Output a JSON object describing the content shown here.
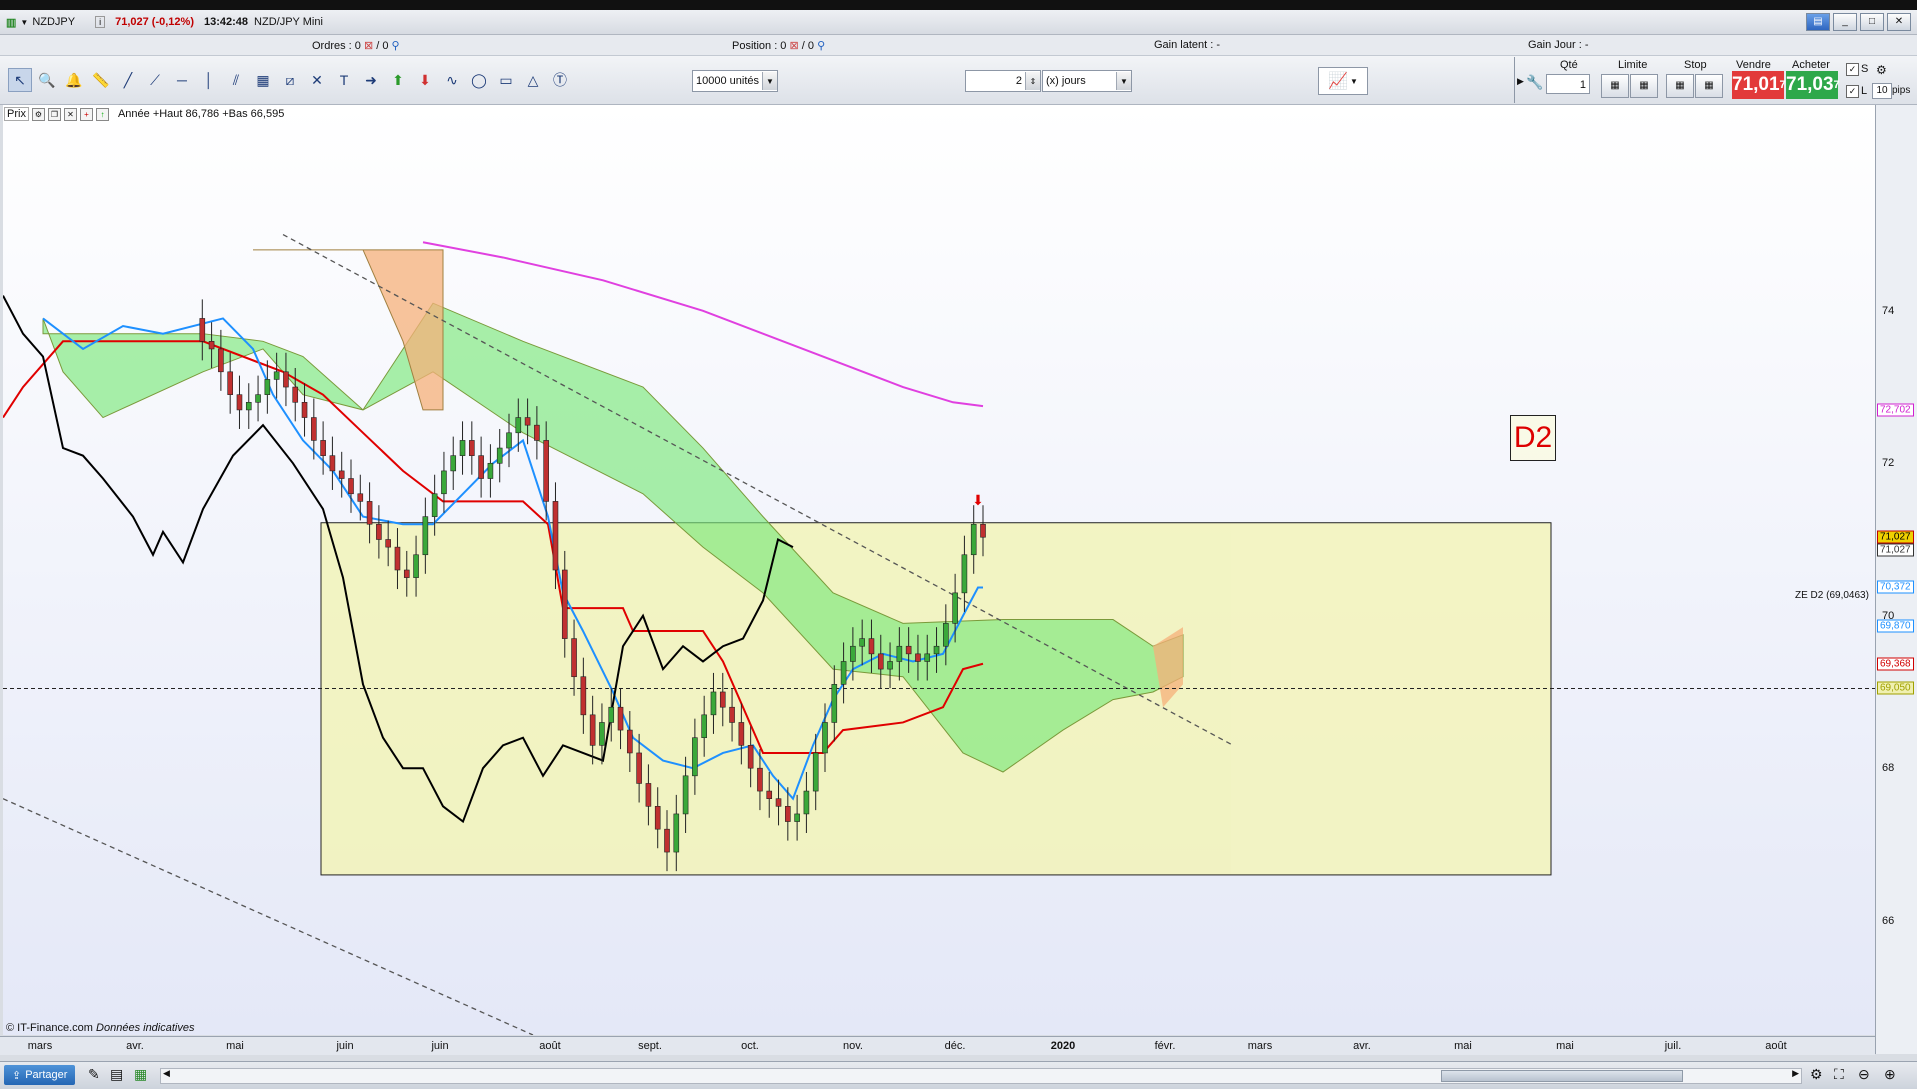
{
  "window": {
    "symbol": "NZDJPY",
    "price_change": "71,027 (-0,12%)",
    "time": "13:42:48",
    "instrument": "NZD/JPY Mini"
  },
  "infobar": {
    "orders_label": "Ordres : 0",
    "orders_second": "/ 0",
    "position_label": "Position : 0",
    "position_second": "/ 0",
    "gain_latent": "Gain latent : -",
    "gain_jour": "Gain Jour : -"
  },
  "toolbar": {
    "units_value": "10000 unités",
    "period_value": "2",
    "period_unit": "(x) jours"
  },
  "trade_panel": {
    "qty_label": "Qté",
    "qty_value": "1",
    "limit_label": "Limite",
    "stop_label": "Stop",
    "sell_label": "Vendre",
    "sell_price_main": "71,01",
    "sell_price_sup": "7",
    "buy_label": "Acheter",
    "buy_price_main": "71,03",
    "buy_price_sup": "7",
    "s_label": "S",
    "l_label": "L",
    "pips_value": "10",
    "pips_label": "pips"
  },
  "legend": {
    "text": "Prix",
    "range_text": "Année  +Haut 86,786  +Bas 66,595"
  },
  "chart_data": {
    "type": "candlestick",
    "title": "",
    "xlabel": "",
    "ylabel": "",
    "ylim": [
      64.5,
      76.7
    ],
    "y_ticks": [
      "74",
      "72",
      "70",
      "68",
      "66"
    ],
    "x_tick_labels": [
      "mars",
      "avr.",
      "mai",
      "juin",
      "juin",
      "août",
      "sept.",
      "oct.",
      "nov.",
      "déc.",
      "2020",
      "févr.",
      "mars",
      "avr.",
      "mai",
      "mai",
      "juil.",
      "août"
    ],
    "price_tags": [
      {
        "label": "72,702",
        "value": 72.702,
        "color": "#d020d0"
      },
      {
        "label": "71,027",
        "value": 71.027,
        "color": "#c00000",
        "filled": true
      },
      {
        "label": "71,027",
        "value": 70.86,
        "color": "#333333"
      },
      {
        "label": "70,372",
        "value": 70.372,
        "color": "#1e90ff"
      },
      {
        "label": "69,870",
        "value": 69.87,
        "color": "#1e90ff"
      },
      {
        "label": "69,368",
        "value": 69.368,
        "color": "#d00000"
      },
      {
        "label": "69,050",
        "value": 69.05,
        "color": "#a0a000",
        "bg": "#f0f0b0"
      }
    ],
    "zone": {
      "label": "D2",
      "top": 71.22,
      "bottom": 66.6
    },
    "ze_line": {
      "label": "ZE D2 (69,0463)",
      "value": 69.0463
    },
    "close_series": [
      73.9,
      73.6,
      73.5,
      73.2,
      72.9,
      72.7,
      72.8,
      72.9,
      73.1,
      73.2,
      73.0,
      72.8,
      72.6,
      72.3,
      72.1,
      71.9,
      71.8,
      71.6,
      71.5,
      71.2,
      71.0,
      70.9,
      70.6,
      70.5,
      70.8,
      71.3,
      71.6,
      71.9,
      72.1,
      72.3,
      72.1,
      71.8,
      72.0,
      72.2,
      72.4,
      72.6,
      72.5,
      72.3,
      71.5,
      70.6,
      69.7,
      69.2,
      68.7,
      68.3,
      68.6,
      68.8,
      68.5,
      68.2,
      67.8,
      67.5,
      67.2,
      66.9,
      67.4,
      67.9,
      68.4,
      68.7,
      69.0,
      68.8,
      68.6,
      68.3,
      68.0,
      67.7,
      67.6,
      67.5,
      67.3,
      67.4,
      67.7,
      68.2,
      68.6,
      69.1,
      69.4,
      69.6,
      69.7,
      69.5,
      69.3,
      69.4,
      69.6,
      69.5,
      69.4,
      69.5,
      69.6,
      69.9,
      70.3,
      70.8,
      71.2,
      71.03
    ],
    "series": [
      {
        "name": "",
        "kind": "tenkan",
        "color": "#1e90ff"
      },
      {
        "name": "",
        "kind": "kijun",
        "color": "#e00000"
      },
      {
        "name": "",
        "kind": "chikou",
        "color": "#000000"
      },
      {
        "name": "",
        "kind": "ma200",
        "color": "#e040e0"
      }
    ],
    "grid": false,
    "legend_position": "top-left"
  },
  "copyright": {
    "text": "© IT-Finance.com",
    "italic": "Données indicatives"
  },
  "bottombar": {
    "share_label": "Partager"
  },
  "colors": {
    "sell": "#e23a3a",
    "buy": "#2ea84a",
    "zone_fill": "#f2f3b8",
    "bull_candle": "#3aa83a",
    "bear_candle": "#c03030"
  }
}
